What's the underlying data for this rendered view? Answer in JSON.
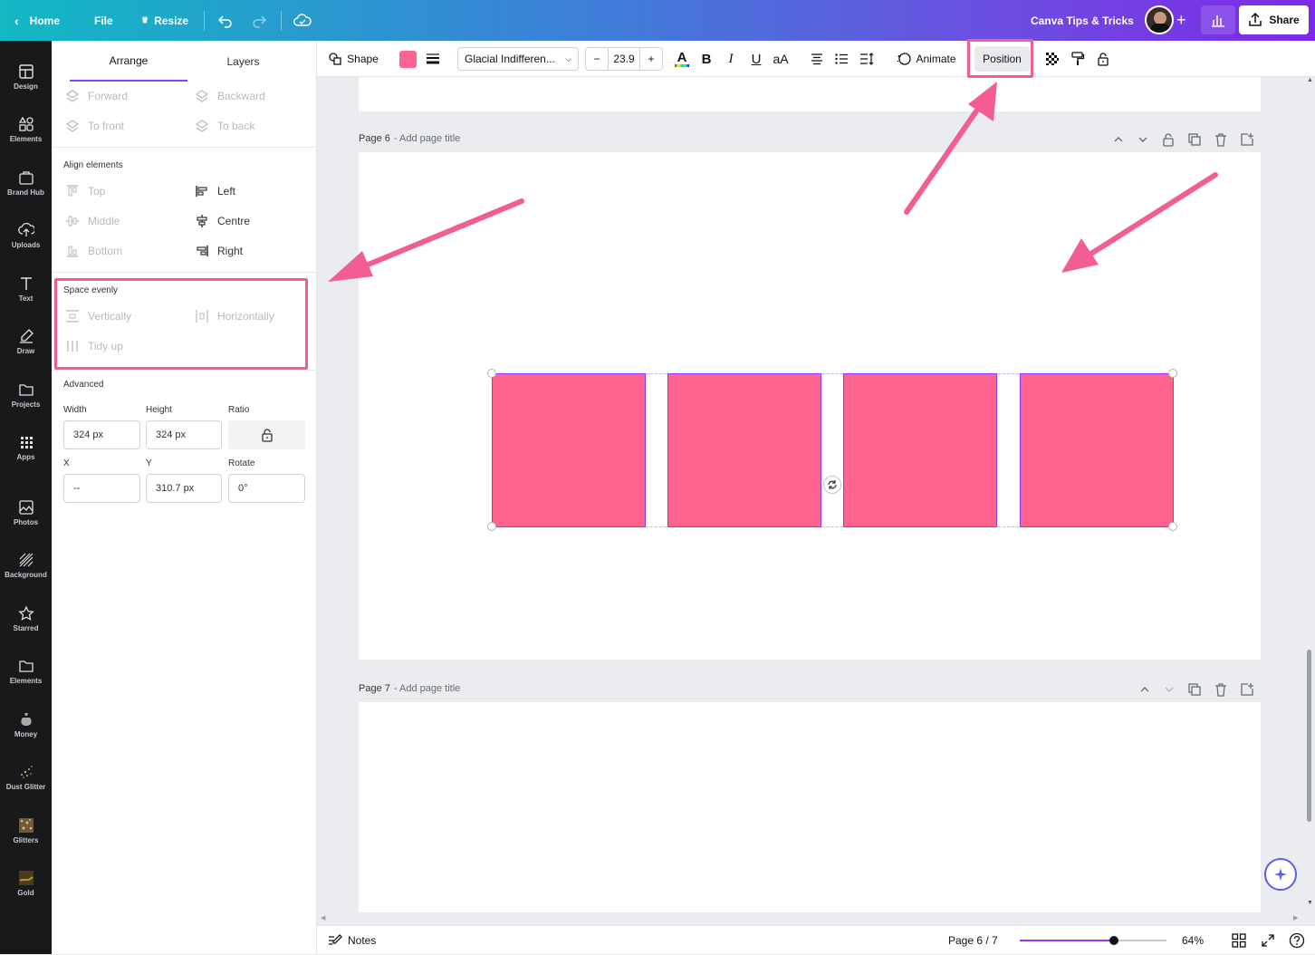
{
  "topbar": {
    "home": "Home",
    "file": "File",
    "resize": "Resize",
    "brand_name": "Canva Tips & Tricks",
    "share": "Share"
  },
  "left_nav": {
    "items": [
      "Design",
      "Elements",
      "Brand Hub",
      "Uploads",
      "Text",
      "Draw",
      "Projects",
      "Apps",
      "Photos",
      "Background",
      "Starred",
      "Elements",
      "Money",
      "Dust Glitter",
      "Glitters",
      "Gold"
    ]
  },
  "panel": {
    "tabs": [
      "Arrange",
      "Layers"
    ],
    "layer_order": {
      "forward": "Forward",
      "backward": "Backward",
      "to_front": "To front",
      "to_back": "To back"
    },
    "align": {
      "heading": "Align elements",
      "top": "Top",
      "left": "Left",
      "middle": "Middle",
      "centre": "Centre",
      "bottom": "Bottom",
      "right": "Right"
    },
    "space": {
      "heading": "Space evenly",
      "vertically": "Vertically",
      "horizontally": "Horizontally",
      "tidy": "Tidy up"
    },
    "advanced": {
      "heading": "Advanced",
      "width_label": "Width",
      "height_label": "Height",
      "ratio_label": "Ratio",
      "width": "324 px",
      "height": "324 px",
      "x_label": "X",
      "y_label": "Y",
      "rotate_label": "Rotate",
      "x": "--",
      "y": "310.7 px",
      "rotate": "0°"
    }
  },
  "toolbar": {
    "shape": "Shape",
    "color": "#ff638f",
    "font": "Glacial Indifferen...",
    "minus": "−",
    "font_size": "23.9",
    "plus": "+",
    "bold": "B",
    "italic": "I",
    "underline": "U",
    "case": "aA",
    "animate": "Animate",
    "position": "Position"
  },
  "pages": {
    "page6_label": "Page 6",
    "page6_title": "- Add page title",
    "page7_label": "Page 7",
    "page7_title": "- Add page title"
  },
  "bottombar": {
    "notes": "Notes",
    "page_count": "Page 6 / 7",
    "zoom": "64%",
    "zoom_level": 0.64
  },
  "colors": {
    "accent": "#f25d94",
    "shape_fill": "#ff638f",
    "selection": "#8b3dff"
  }
}
